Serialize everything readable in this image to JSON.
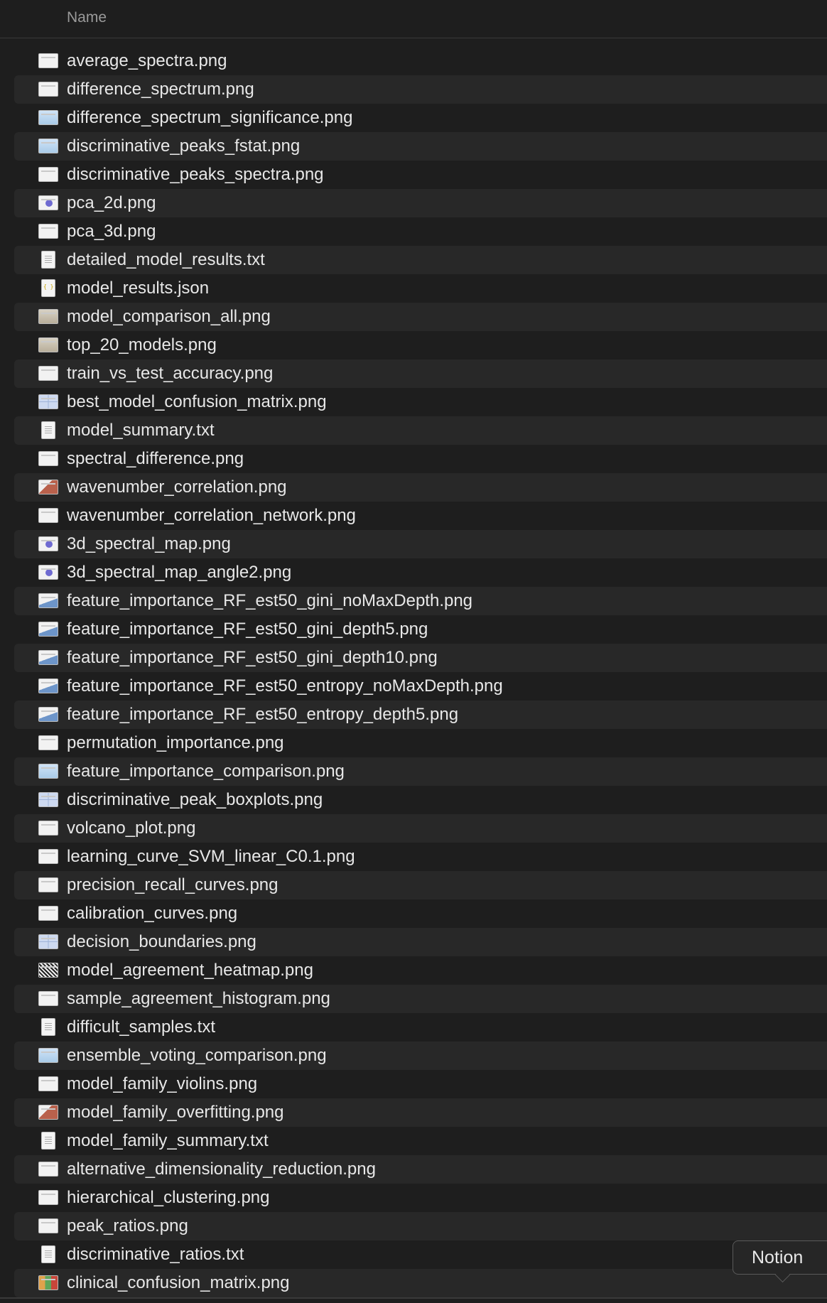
{
  "header": {
    "name_column": "Name"
  },
  "files": [
    {
      "name": "average_spectra.png",
      "icon": "image-icon",
      "style": "img"
    },
    {
      "name": "difference_spectrum.png",
      "icon": "image-icon",
      "style": "img"
    },
    {
      "name": "difference_spectrum_significance.png",
      "icon": "image-icon",
      "style": "img blue"
    },
    {
      "name": "discriminative_peaks_fstat.png",
      "icon": "image-icon",
      "style": "img blue"
    },
    {
      "name": "discriminative_peaks_spectra.png",
      "icon": "image-icon",
      "style": "img"
    },
    {
      "name": "pca_2d.png",
      "icon": "image-icon",
      "style": "img purple"
    },
    {
      "name": "pca_3d.png",
      "icon": "image-icon",
      "style": "img"
    },
    {
      "name": "detailed_model_results.txt",
      "icon": "text-document-icon",
      "style": "txt"
    },
    {
      "name": "model_results.json",
      "icon": "json-document-icon",
      "style": "json"
    },
    {
      "name": "model_comparison_all.png",
      "icon": "image-icon",
      "style": "img tan"
    },
    {
      "name": "top_20_models.png",
      "icon": "image-icon",
      "style": "img tan"
    },
    {
      "name": "train_vs_test_accuracy.png",
      "icon": "image-icon",
      "style": "img"
    },
    {
      "name": "best_model_confusion_matrix.png",
      "icon": "image-icon",
      "style": "img grid"
    },
    {
      "name": "model_summary.txt",
      "icon": "text-document-icon",
      "style": "txt"
    },
    {
      "name": "spectral_difference.png",
      "icon": "image-icon",
      "style": "img"
    },
    {
      "name": "wavenumber_correlation.png",
      "icon": "image-icon",
      "style": "img red"
    },
    {
      "name": "wavenumber_correlation_network.png",
      "icon": "image-icon",
      "style": "img"
    },
    {
      "name": "3d_spectral_map.png",
      "icon": "image-icon",
      "style": "img purple"
    },
    {
      "name": "3d_spectral_map_angle2.png",
      "icon": "image-icon",
      "style": "img purple"
    },
    {
      "name": "feature_importance_RF_est50_gini_noMaxDepth.png",
      "icon": "image-icon",
      "style": "img fi"
    },
    {
      "name": "feature_importance_RF_est50_gini_depth5.png",
      "icon": "image-icon",
      "style": "img fi"
    },
    {
      "name": "feature_importance_RF_est50_gini_depth10.png",
      "icon": "image-icon",
      "style": "img fi"
    },
    {
      "name": "feature_importance_RF_est50_entropy_noMaxDepth.png",
      "icon": "image-icon",
      "style": "img fi"
    },
    {
      "name": "feature_importance_RF_est50_entropy_depth5.png",
      "icon": "image-icon",
      "style": "img fi"
    },
    {
      "name": "permutation_importance.png",
      "icon": "image-icon",
      "style": "img"
    },
    {
      "name": "feature_importance_comparison.png",
      "icon": "image-icon",
      "style": "img blue"
    },
    {
      "name": "discriminative_peak_boxplots.png",
      "icon": "image-icon",
      "style": "img grid"
    },
    {
      "name": "volcano_plot.png",
      "icon": "image-icon",
      "style": "img"
    },
    {
      "name": "learning_curve_SVM_linear_C0.1.png",
      "icon": "image-icon",
      "style": "img"
    },
    {
      "name": "precision_recall_curves.png",
      "icon": "image-icon",
      "style": "img"
    },
    {
      "name": "calibration_curves.png",
      "icon": "image-icon",
      "style": "img"
    },
    {
      "name": "decision_boundaries.png",
      "icon": "image-icon",
      "style": "img grid"
    },
    {
      "name": "model_agreement_heatmap.png",
      "icon": "image-icon",
      "style": "img heat"
    },
    {
      "name": "sample_agreement_histogram.png",
      "icon": "image-icon",
      "style": "img"
    },
    {
      "name": "difficult_samples.txt",
      "icon": "text-document-icon",
      "style": "txt"
    },
    {
      "name": "ensemble_voting_comparison.png",
      "icon": "image-icon",
      "style": "img blue"
    },
    {
      "name": "model_family_violins.png",
      "icon": "image-icon",
      "style": "img"
    },
    {
      "name": "model_family_overfitting.png",
      "icon": "image-icon",
      "style": "img red"
    },
    {
      "name": "model_family_summary.txt",
      "icon": "text-document-icon",
      "style": "txt"
    },
    {
      "name": "alternative_dimensionality_reduction.png",
      "icon": "image-icon",
      "style": "img"
    },
    {
      "name": "hierarchical_clustering.png",
      "icon": "image-icon",
      "style": "img"
    },
    {
      "name": "peak_ratios.png",
      "icon": "image-icon",
      "style": "img"
    },
    {
      "name": "discriminative_ratios.txt",
      "icon": "text-document-icon",
      "style": "txt"
    },
    {
      "name": "clinical_confusion_matrix.png",
      "icon": "image-icon",
      "style": "img multi"
    }
  ],
  "tooltip": {
    "text": "Notion"
  }
}
